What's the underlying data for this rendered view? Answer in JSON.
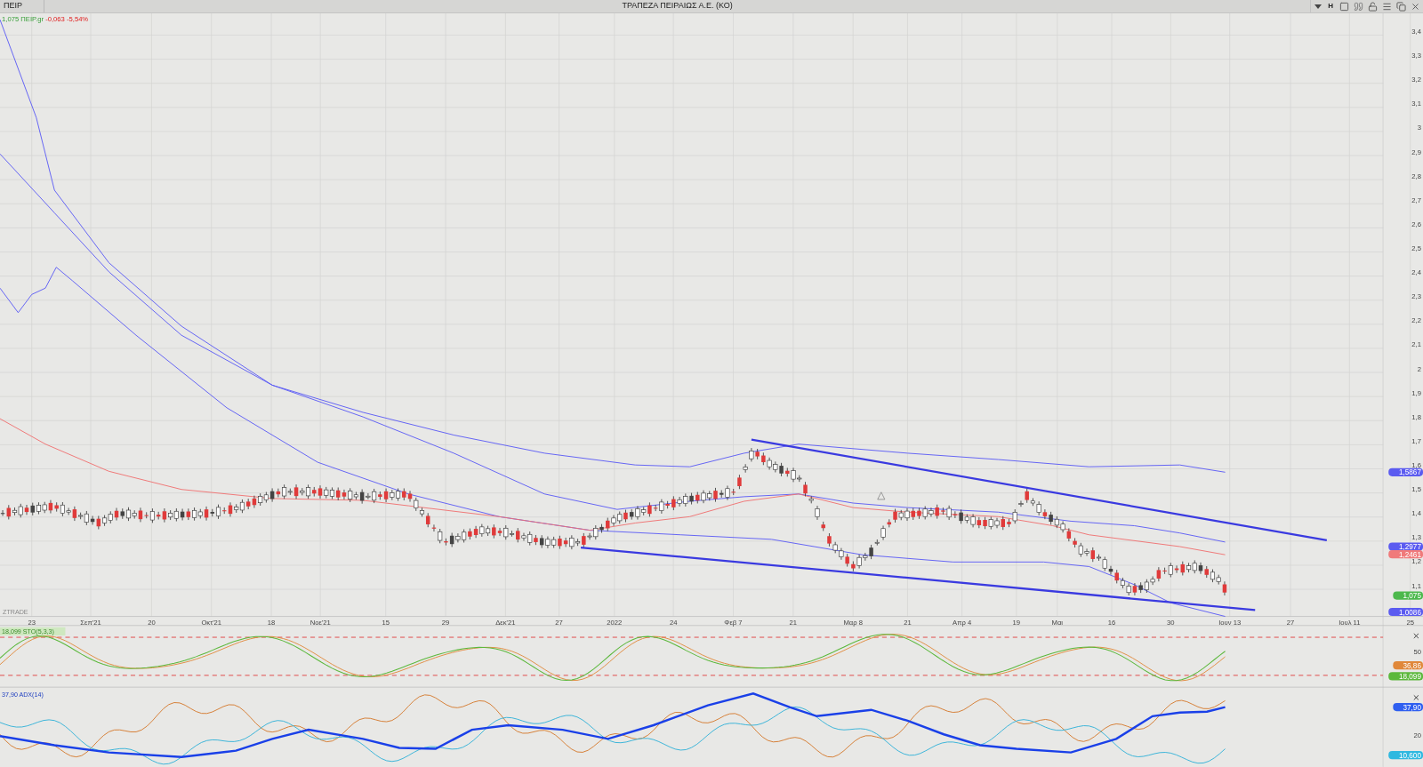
{
  "header": {
    "symbol_tab": "ΠΕΙΡ",
    "title": "ΤΡΑΠΕΖΑ ΠΕΙΡΑΙΩΣ Α.Ε. (ΚΟ)",
    "mode_label": "H"
  },
  "price_panel": {
    "legend": {
      "last": "1,075 ΠΕΙΡ.gr",
      "change": "-0,063 -5,54%"
    },
    "watermark": "ZTRADE",
    "y_ticks": [
      "3,4",
      "3,3",
      "3,2",
      "3,1",
      "3",
      "2,9",
      "2,8",
      "2,7",
      "2,6",
      "2,5",
      "2,4",
      "2,3",
      "2,2",
      "2,1",
      "2",
      "1,9",
      "1,8",
      "1,7",
      "1,6",
      "1,5",
      "1,4",
      "1,3",
      "1,2",
      "1,1"
    ],
    "badges": [
      {
        "text": "1,5867",
        "color": "#5b5bf0"
      },
      {
        "text": "1,2977",
        "color": "#5b5bf0"
      },
      {
        "text": "1,2461",
        "color": "#f07a7a"
      },
      {
        "text": "1,075",
        "color": "#4cb84c"
      },
      {
        "text": "1,0086",
        "color": "#5b5bf0"
      }
    ]
  },
  "x_ticks": [
    "23",
    "Σεπ'21",
    "20",
    "Οκτ'21",
    "18",
    "Νοε'21",
    "15",
    "29",
    "Δεκ'21",
    "27",
    "2022",
    "24",
    "Φεβ 7",
    "21",
    "Μαρ 8",
    "21",
    "Απρ 4",
    "19",
    "Μαι",
    "16",
    "30",
    "Ιουν 13",
    "27",
    "Ιουλ 11",
    "25"
  ],
  "stoch_panel": {
    "legend": "18,099 STO(5,3,3)",
    "y_ticks": [
      "50"
    ],
    "badges": [
      {
        "text": "36,86",
        "color": "#e0883a"
      },
      {
        "text": "18,099",
        "color": "#5cb83c"
      }
    ]
  },
  "adx_panel": {
    "legend": "37,90 ADX(14)",
    "y_ticks": [
      "20"
    ],
    "badges": [
      {
        "text": "37,90",
        "color": "#2f5ff0"
      },
      {
        "text": "10,600",
        "color": "#2fb8e0"
      }
    ]
  }
}
